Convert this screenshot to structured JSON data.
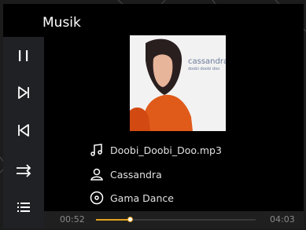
{
  "app": {
    "title": "Musik"
  },
  "sidebar": {
    "items": [
      {
        "icon": "pause-icon"
      },
      {
        "icon": "next-track-icon"
      },
      {
        "icon": "previous-track-icon"
      },
      {
        "icon": "repeat-icon"
      },
      {
        "icon": "playlist-icon"
      }
    ]
  },
  "album": {
    "artist_text": "cassandra",
    "subtitle_text": "doobi doobi doo"
  },
  "track": {
    "file_name": "Doobi_Doobi_Doo.mp3",
    "artist": "Cassandra",
    "album": "Gama Dance"
  },
  "progress": {
    "elapsed": "00:52",
    "total": "04:03",
    "fraction": 0.214
  },
  "colors": {
    "accent": "#e5a21c",
    "sidebar": "#202124",
    "background": "#000000"
  }
}
